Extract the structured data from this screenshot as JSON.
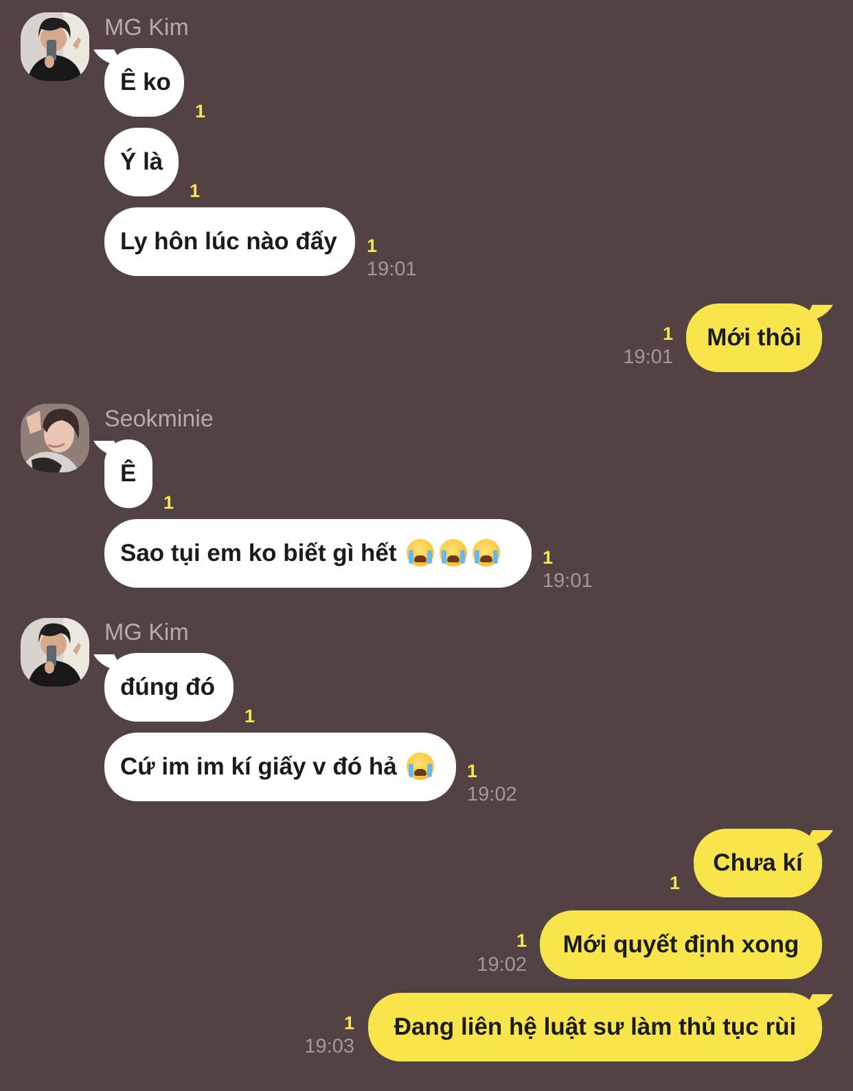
{
  "messages": [
    {
      "sender": "MG Kim",
      "text": "Ê ko",
      "unread": "1"
    },
    {
      "text": "Ý là",
      "unread": "1"
    },
    {
      "text": "Ly hôn lúc nào đấy",
      "unread": "1",
      "time": "19:01"
    },
    {
      "text": "Mới thôi",
      "unread": "1",
      "time": "19:01"
    },
    {
      "sender": "Seokminie",
      "text": "Ê",
      "unread": "1"
    },
    {
      "text": "Sao tụi em ko biết gì hết",
      "emoji": "loudly-crying-face-icon",
      "emoji_count": 3,
      "unread": "1",
      "time": "19:01"
    },
    {
      "sender": "MG Kim",
      "text": "đúng đó",
      "unread": "1"
    },
    {
      "text": "Cứ im im kí giấy v đó hả",
      "emoji": "loudly-crying-face-icon",
      "emoji_count": 1,
      "unread": "1",
      "time": "19:02"
    },
    {
      "text": "Chưa kí",
      "unread": "1"
    },
    {
      "text": "Mới quyết định xong",
      "unread": "1",
      "time": "19:02"
    },
    {
      "text": "Đang liên hệ luật sư làm thủ tục rùi",
      "unread": "1",
      "time": "19:03"
    }
  ],
  "colors": {
    "background": "#524243",
    "incoming_bubble": "#ffffff",
    "outgoing_bubble": "#f8e54c",
    "unread_count": "#f8e54c",
    "timestamp": "#a4999a"
  }
}
